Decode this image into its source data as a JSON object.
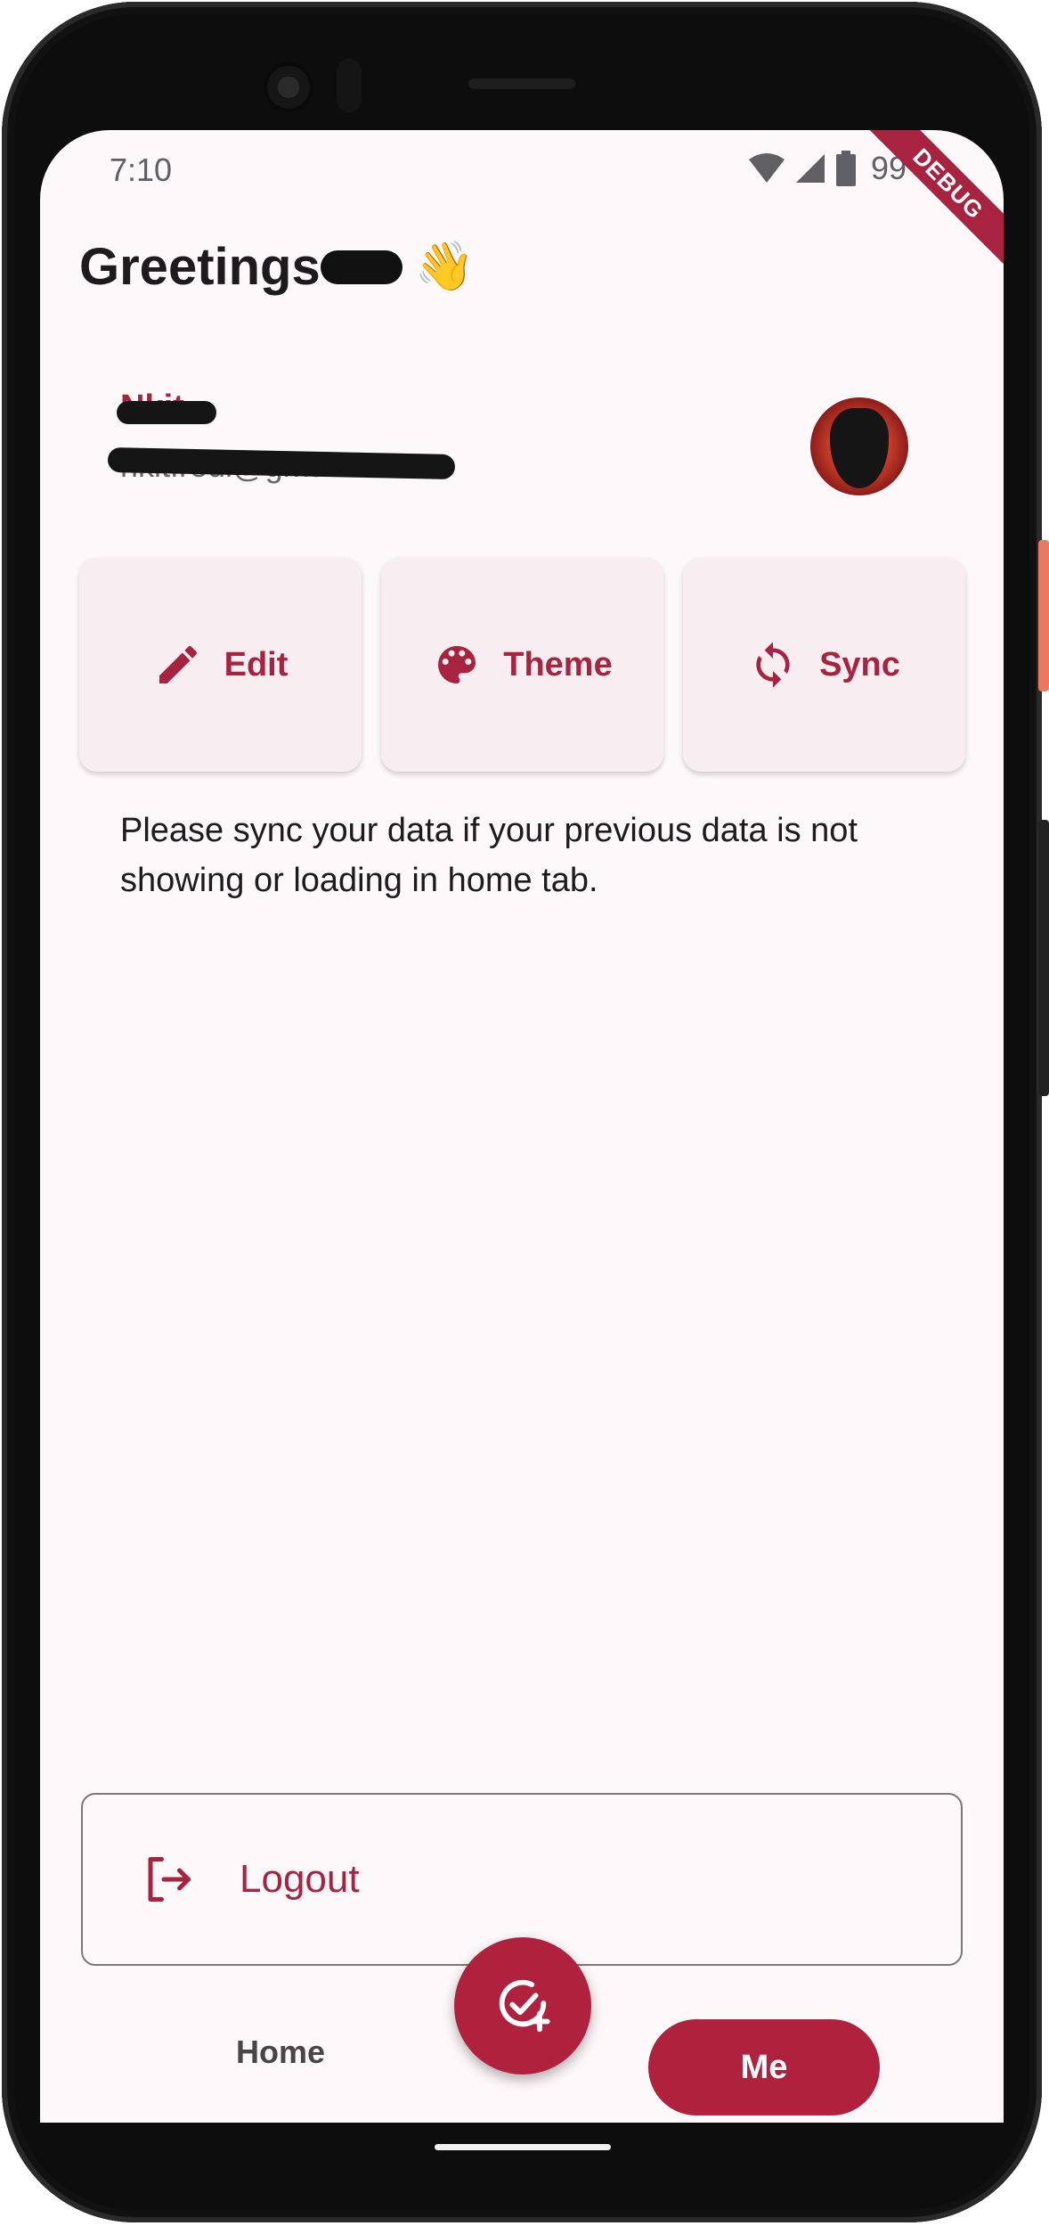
{
  "status_bar": {
    "time": "7:10",
    "battery_text": "99",
    "icons": [
      "wifi-icon",
      "signal-icon",
      "battery-icon"
    ]
  },
  "debug_banner": "DEBUG",
  "header": {
    "greeting": "Greetings",
    "emoji": "👋"
  },
  "profile": {
    "name": "Nkit",
    "email": "nkitfredi@gmail"
  },
  "actions": [
    {
      "label": "Edit",
      "icon": "pencil-icon"
    },
    {
      "label": "Theme",
      "icon": "palette-icon"
    },
    {
      "label": "Sync",
      "icon": "sync-icon"
    }
  ],
  "sync_note": "Please sync your data if your previous data is not showing or loading in home tab.",
  "logout": {
    "label": "Logout",
    "icon": "logout-icon"
  },
  "bottom_nav": {
    "home_label": "Home",
    "me_label": "Me",
    "fab_icon": "add-task-icon"
  },
  "colors": {
    "accent": "#b0213e",
    "background": "#fdf8fa",
    "card": "#f8eef2",
    "text": "#1e1a1d"
  }
}
